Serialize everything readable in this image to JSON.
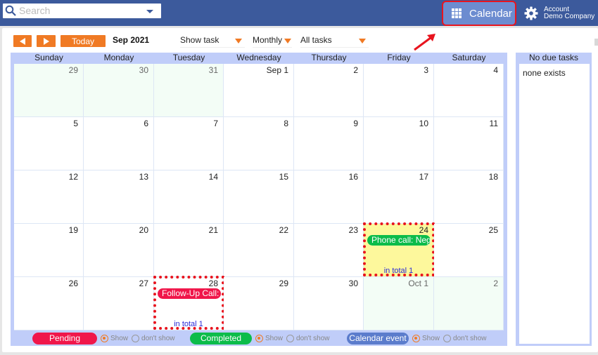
{
  "topbar": {
    "search_placeholder": "Search",
    "search_icon": "search-icon",
    "calendar_button": {
      "label": "Calendar",
      "icon": "grid-icon",
      "highlighted": true,
      "highlight_color": "#e8141e"
    },
    "account": {
      "icon": "gear-icon",
      "line1": "Account",
      "line2": "Demo Company"
    }
  },
  "toolbar": {
    "prev_icon": "triangle-left-icon",
    "next_icon": "triangle-right-icon",
    "today_label": "Today",
    "month_label": "Sep 2021",
    "show_task_select": "Show task",
    "view_select": "Monthly",
    "filter_select": "All tasks"
  },
  "calendar": {
    "weekdays": [
      "Sunday",
      "Monday",
      "Tuesday",
      "Wednesday",
      "Thursday",
      "Friday",
      "Saturday"
    ],
    "weeks": [
      [
        {
          "d": "29",
          "other": true
        },
        {
          "d": "30",
          "other": true
        },
        {
          "d": "31",
          "other": true
        },
        {
          "d": "Sep 1"
        },
        {
          "d": "2"
        },
        {
          "d": "3"
        },
        {
          "d": "4"
        }
      ],
      [
        {
          "d": "5"
        },
        {
          "d": "6"
        },
        {
          "d": "7"
        },
        {
          "d": "8"
        },
        {
          "d": "9"
        },
        {
          "d": "10"
        },
        {
          "d": "11"
        }
      ],
      [
        {
          "d": "12"
        },
        {
          "d": "13"
        },
        {
          "d": "14"
        },
        {
          "d": "15"
        },
        {
          "d": "16"
        },
        {
          "d": "17"
        },
        {
          "d": "18"
        }
      ],
      [
        {
          "d": "19"
        },
        {
          "d": "20"
        },
        {
          "d": "21"
        },
        {
          "d": "22"
        },
        {
          "d": "23"
        },
        {
          "d": "24",
          "highlight": true,
          "event": {
            "label": "Phone call: Neg",
            "status": "completed"
          },
          "total": "in total 1"
        },
        {
          "d": "25"
        }
      ],
      [
        {
          "d": "26"
        },
        {
          "d": "27"
        },
        {
          "d": "28",
          "event": {
            "label": "Follow-Up Call:",
            "status": "pending"
          },
          "total": "in total 1"
        },
        {
          "d": "29"
        },
        {
          "d": "30"
        },
        {
          "d": "Oct 1",
          "other": true
        },
        {
          "d": "2",
          "other": true
        }
      ]
    ]
  },
  "legend": [
    {
      "label": "Pending",
      "color": "#f0164a",
      "show": "Show",
      "hide": "don't show",
      "selected": "show"
    },
    {
      "label": "Completed",
      "color": "#0cbc4a",
      "show": "Show",
      "hide": "don't show",
      "selected": "show"
    },
    {
      "label": "Calendar event",
      "color": "#5b7ccc",
      "show": "Show",
      "hide": "don't show",
      "selected": "show"
    }
  ],
  "side_panel": {
    "title": "No due tasks",
    "body": "none exists"
  },
  "colors": {
    "topbar": "#3c5a9c",
    "accent_orange": "#f07a24",
    "pending": "#f0164a",
    "completed": "#0cbc4a",
    "calendar_event": "#5b7ccc"
  }
}
